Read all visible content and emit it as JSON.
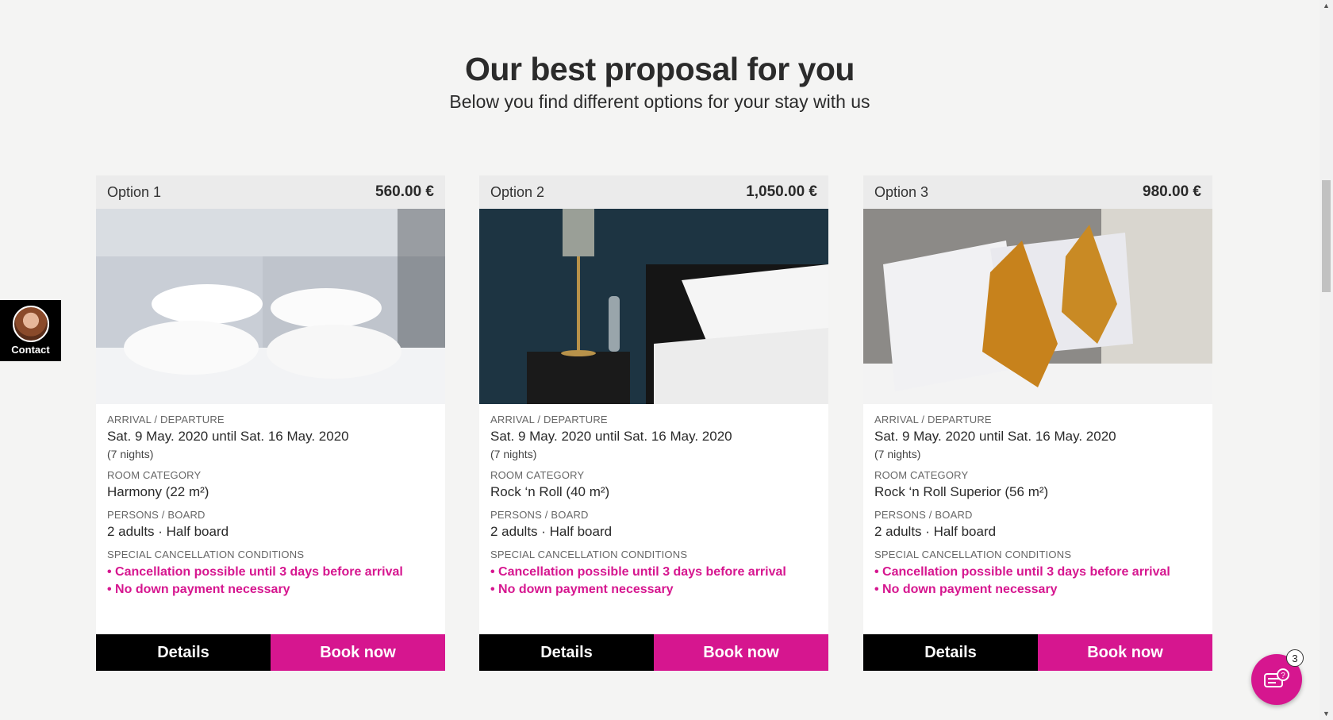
{
  "header": {
    "title": "Our best proposal for you",
    "subtitle": "Below you find different options for your stay with us"
  },
  "labels": {
    "arrival": "ARRIVAL / DEPARTURE",
    "room": "ROOM CATEGORY",
    "persons": "PERSONS / BOARD",
    "cancellation": "SPECIAL CANCELLATION CONDITIONS",
    "details_button": "Details",
    "book_button": "Book now"
  },
  "options": [
    {
      "label": "Option 1",
      "price": "560.00 €",
      "dates": "Sat. 9 May. 2020 until Sat. 16 May. 2020",
      "nights": "(7 nights)",
      "room": "Harmony (22 m²)",
      "persons": "2 adults · Half board",
      "conditions": [
        "• Cancellation possible until 3 days before arrival",
        "• No down payment necessary"
      ]
    },
    {
      "label": "Option 2",
      "price": "1,050.00 €",
      "dates": "Sat. 9 May. 2020 until Sat. 16 May. 2020",
      "nights": "(7 nights)",
      "room": "Rock ‘n Roll (40 m²)",
      "persons": "2 adults · Half board",
      "conditions": [
        "• Cancellation possible until 3 days before arrival",
        "• No down payment necessary"
      ]
    },
    {
      "label": "Option 3",
      "price": "980.00 €",
      "dates": "Sat. 9 May. 2020 until Sat. 16 May. 2020",
      "nights": "(7 nights)",
      "room": "Rock ‘n Roll Superior (56 m²)",
      "persons": "2 adults · Half board",
      "conditions": [
        "• Cancellation possible until 3 days before arrival",
        "• No down payment necessary"
      ]
    }
  ],
  "contact": {
    "label": "Contact"
  },
  "chat": {
    "badge": "3",
    "icon": "chat-help-icon"
  },
  "colors": {
    "accent": "#d6168f",
    "dark": "#000000",
    "background": "#f4f4f3"
  }
}
